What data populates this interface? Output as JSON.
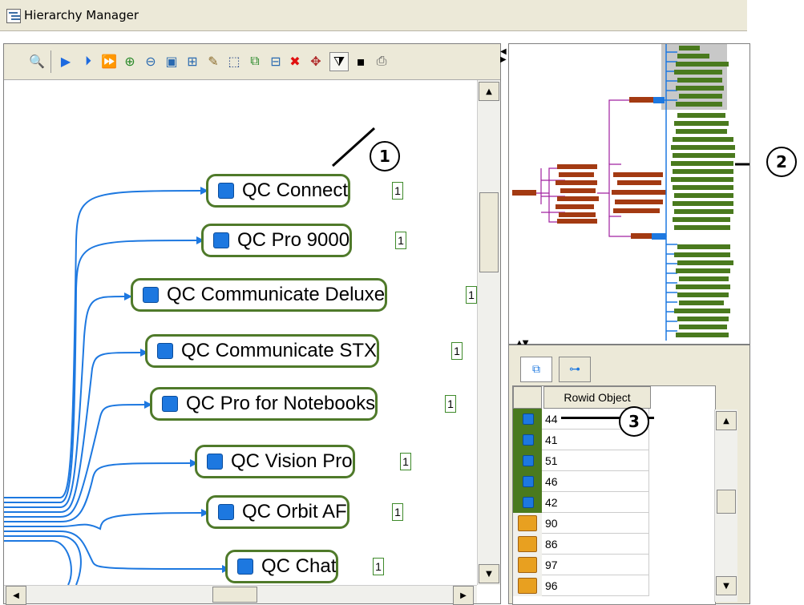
{
  "window": {
    "title": "Hierarchy Manager"
  },
  "nodes": [
    {
      "label": "QC Connect",
      "badge": "1"
    },
    {
      "label": "QC Pro 9000",
      "badge": "1"
    },
    {
      "label": "QC Communicate Deluxe",
      "badge": "1"
    },
    {
      "label": "QC Communicate STX",
      "badge": "1"
    },
    {
      "label": "QC Pro for Notebooks",
      "badge": "1"
    },
    {
      "label": "QC Vision Pro",
      "badge": "1"
    },
    {
      "label": "QC Orbit AF",
      "badge": "1"
    },
    {
      "label": "QC Chat",
      "badge": "1"
    }
  ],
  "callouts": [
    "1",
    "2",
    "3"
  ],
  "grid": {
    "column": "Rowid Object",
    "rows": [
      {
        "value": "41",
        "type": "record"
      },
      {
        "value": "51",
        "type": "record"
      },
      {
        "value": "46",
        "type": "record"
      },
      {
        "value": "42",
        "type": "record"
      },
      {
        "value": "90",
        "type": "folder"
      },
      {
        "value": "86",
        "type": "folder"
      },
      {
        "value": "97",
        "type": "folder"
      },
      {
        "value": "96",
        "type": "folder"
      }
    ],
    "partial_first_row": "44"
  },
  "colors": {
    "node_border": "#4f7a2a",
    "connector": "#1d78e0",
    "overview_green": "#4a7a1e",
    "overview_red": "#a33a12"
  }
}
